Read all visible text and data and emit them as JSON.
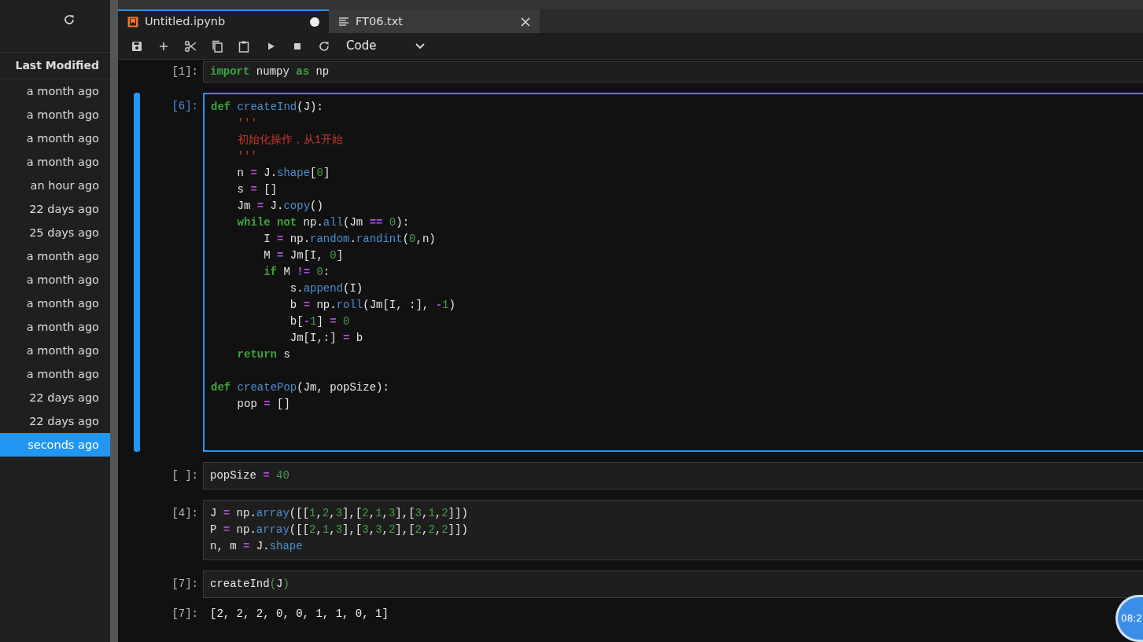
{
  "sidebar": {
    "header": "Last Modified",
    "items": [
      {
        "label": "a month ago",
        "selected": false
      },
      {
        "label": "a month ago",
        "selected": false
      },
      {
        "label": "a month ago",
        "selected": false
      },
      {
        "label": "a month ago",
        "selected": false
      },
      {
        "label": "an hour ago",
        "selected": false
      },
      {
        "label": "22 days ago",
        "selected": false
      },
      {
        "label": "25 days ago",
        "selected": false
      },
      {
        "label": "a month ago",
        "selected": false
      },
      {
        "label": "a month ago",
        "selected": false
      },
      {
        "label": "a month ago",
        "selected": false
      },
      {
        "label": "a month ago",
        "selected": false
      },
      {
        "label": "a month ago",
        "selected": false
      },
      {
        "label": "a month ago",
        "selected": false
      },
      {
        "label": "22 days ago",
        "selected": false
      },
      {
        "label": "22 days ago",
        "selected": false
      },
      {
        "label": "seconds ago",
        "selected": true
      }
    ]
  },
  "tabs": [
    {
      "label": "Untitled.ipynb",
      "kind": "notebook",
      "selected": true,
      "modified": true
    },
    {
      "label": "FT06.txt",
      "kind": "text",
      "selected": false,
      "modified": false
    }
  ],
  "toolbar": {
    "cell_type": "Code"
  },
  "cells": [
    {
      "prompt": "[1]:",
      "active": false,
      "lines": [
        {
          "segments": [
            {
              "text": "import",
              "kind": "keyword"
            },
            {
              "text": " numpy ",
              "kind": "plain"
            },
            {
              "text": "as",
              "kind": "keyword"
            },
            {
              "text": " np",
              "kind": "plain"
            }
          ]
        }
      ]
    },
    {
      "prompt": "[6]:",
      "active": true,
      "extra_space": true,
      "lines": [
        {
          "segments": [
            {
              "text": "def",
              "kind": "keyword"
            },
            {
              "text": " createInd",
              "kind": "function"
            },
            {
              "text": "(J):",
              "kind": "plain"
            }
          ]
        },
        {
          "segments": [
            {
              "text": "    '''",
              "kind": "string"
            }
          ]
        },
        {
          "segments": [
            {
              "text": "    初始化操作，从1开始",
              "kind": "string"
            }
          ]
        },
        {
          "segments": [
            {
              "text": "    '''",
              "kind": "string"
            }
          ]
        },
        {
          "segments": [
            {
              "text": "    n ",
              "kind": "plain"
            },
            {
              "text": "=",
              "kind": "operator"
            },
            {
              "text": " J.",
              "kind": "plain"
            },
            {
              "text": "shape",
              "kind": "function"
            },
            {
              "text": "[",
              "kind": "plain"
            },
            {
              "text": "0",
              "kind": "number"
            },
            {
              "text": "]",
              "kind": "plain"
            }
          ]
        },
        {
          "segments": [
            {
              "text": "    s ",
              "kind": "plain"
            },
            {
              "text": "=",
              "kind": "operator"
            },
            {
              "text": " []",
              "kind": "plain"
            }
          ]
        },
        {
          "segments": [
            {
              "text": "    Jm ",
              "kind": "plain"
            },
            {
              "text": "=",
              "kind": "operator"
            },
            {
              "text": " J.",
              "kind": "plain"
            },
            {
              "text": "copy",
              "kind": "function"
            },
            {
              "text": "()",
              "kind": "plain"
            }
          ]
        },
        {
          "segments": [
            {
              "text": "    while not",
              "kind": "keyword"
            },
            {
              "text": " np.",
              "kind": "plain"
            },
            {
              "text": "all",
              "kind": "function"
            },
            {
              "text": "(Jm ",
              "kind": "plain"
            },
            {
              "text": "==",
              "kind": "operator"
            },
            {
              "text": " 0",
              "kind": "number"
            },
            {
              "text": "):",
              "kind": "plain"
            }
          ]
        },
        {
          "segments": [
            {
              "text": "        I ",
              "kind": "plain"
            },
            {
              "text": "=",
              "kind": "operator"
            },
            {
              "text": " np.",
              "kind": "plain"
            },
            {
              "text": "random",
              "kind": "function"
            },
            {
              "text": ".",
              "kind": "plain"
            },
            {
              "text": "randint",
              "kind": "function"
            },
            {
              "text": "(",
              "kind": "plain"
            },
            {
              "text": "0",
              "kind": "number"
            },
            {
              "text": ",n)",
              "kind": "plain"
            }
          ]
        },
        {
          "segments": [
            {
              "text": "        M ",
              "kind": "plain"
            },
            {
              "text": "=",
              "kind": "operator"
            },
            {
              "text": " Jm[I, ",
              "kind": "plain"
            },
            {
              "text": "0",
              "kind": "number"
            },
            {
              "text": "]",
              "kind": "plain"
            }
          ]
        },
        {
          "segments": [
            {
              "text": "        if",
              "kind": "keyword"
            },
            {
              "text": " M ",
              "kind": "plain"
            },
            {
              "text": "!=",
              "kind": "operator"
            },
            {
              "text": " 0",
              "kind": "number"
            },
            {
              "text": ":",
              "kind": "plain"
            }
          ]
        },
        {
          "segments": [
            {
              "text": "            s.",
              "kind": "plain"
            },
            {
              "text": "append",
              "kind": "function"
            },
            {
              "text": "(I)",
              "kind": "plain"
            }
          ]
        },
        {
          "segments": [
            {
              "text": "            b ",
              "kind": "plain"
            },
            {
              "text": "=",
              "kind": "operator"
            },
            {
              "text": " np.",
              "kind": "plain"
            },
            {
              "text": "roll",
              "kind": "function"
            },
            {
              "text": "(Jm[I, :], ",
              "kind": "plain"
            },
            {
              "text": "-",
              "kind": "operator"
            },
            {
              "text": "1",
              "kind": "number"
            },
            {
              "text": ")",
              "kind": "plain"
            }
          ]
        },
        {
          "segments": [
            {
              "text": "            b[",
              "kind": "plain"
            },
            {
              "text": "-",
              "kind": "operator"
            },
            {
              "text": "1",
              "kind": "number"
            },
            {
              "text": "] ",
              "kind": "plain"
            },
            {
              "text": "=",
              "kind": "operator"
            },
            {
              "text": " 0",
              "kind": "number"
            }
          ]
        },
        {
          "segments": [
            {
              "text": "            Jm[I,:] ",
              "kind": "plain"
            },
            {
              "text": "=",
              "kind": "operator"
            },
            {
              "text": " b",
              "kind": "plain"
            }
          ]
        },
        {
          "segments": [
            {
              "text": "    return",
              "kind": "keyword"
            },
            {
              "text": " s",
              "kind": "plain"
            }
          ]
        },
        {
          "gap_before": true,
          "segments": [
            {
              "text": "def",
              "kind": "keyword"
            },
            {
              "text": " createPop",
              "kind": "function"
            },
            {
              "text": "(Jm, popSize):",
              "kind": "plain"
            }
          ]
        },
        {
          "segments": [
            {
              "text": "    pop ",
              "kind": "plain"
            },
            {
              "text": "=",
              "kind": "operator"
            },
            {
              "text": " []",
              "kind": "plain"
            }
          ]
        }
      ]
    },
    {
      "prompt": "[ ]:",
      "active": false,
      "lines": [
        {
          "segments": [
            {
              "text": "popSize ",
              "kind": "plain"
            },
            {
              "text": "=",
              "kind": "operator"
            },
            {
              "text": " 40",
              "kind": "number"
            }
          ]
        }
      ]
    },
    {
      "prompt": "[4]:",
      "active": false,
      "lines": [
        {
          "segments": [
            {
              "text": "J ",
              "kind": "plain"
            },
            {
              "text": "=",
              "kind": "operator"
            },
            {
              "text": " np.",
              "kind": "plain"
            },
            {
              "text": "array",
              "kind": "function"
            },
            {
              "text": "([[",
              "kind": "plain"
            },
            {
              "text": "1",
              "kind": "number"
            },
            {
              "text": ",",
              "kind": "plain"
            },
            {
              "text": "2",
              "kind": "number"
            },
            {
              "text": ",",
              "kind": "plain"
            },
            {
              "text": "3",
              "kind": "number"
            },
            {
              "text": "],[",
              "kind": "plain"
            },
            {
              "text": "2",
              "kind": "number"
            },
            {
              "text": ",",
              "kind": "plain"
            },
            {
              "text": "1",
              "kind": "number"
            },
            {
              "text": ",",
              "kind": "plain"
            },
            {
              "text": "3",
              "kind": "number"
            },
            {
              "text": "],[",
              "kind": "plain"
            },
            {
              "text": "3",
              "kind": "number"
            },
            {
              "text": ",",
              "kind": "plain"
            },
            {
              "text": "1",
              "kind": "number"
            },
            {
              "text": ",",
              "kind": "plain"
            },
            {
              "text": "2",
              "kind": "number"
            },
            {
              "text": "]])",
              "kind": "plain"
            }
          ]
        },
        {
          "segments": [
            {
              "text": "P ",
              "kind": "plain"
            },
            {
              "text": "=",
              "kind": "operator"
            },
            {
              "text": " np.",
              "kind": "plain"
            },
            {
              "text": "array",
              "kind": "function"
            },
            {
              "text": "([[",
              "kind": "plain"
            },
            {
              "text": "2",
              "kind": "number"
            },
            {
              "text": ",",
              "kind": "plain"
            },
            {
              "text": "1",
              "kind": "number"
            },
            {
              "text": ",",
              "kind": "plain"
            },
            {
              "text": "3",
              "kind": "number"
            },
            {
              "text": "],[",
              "kind": "plain"
            },
            {
              "text": "3",
              "kind": "number"
            },
            {
              "text": ",",
              "kind": "plain"
            },
            {
              "text": "3",
              "kind": "number"
            },
            {
              "text": ",",
              "kind": "plain"
            },
            {
              "text": "2",
              "kind": "number"
            },
            {
              "text": "],[",
              "kind": "plain"
            },
            {
              "text": "2",
              "kind": "number"
            },
            {
              "text": ",",
              "kind": "plain"
            },
            {
              "text": "2",
              "kind": "number"
            },
            {
              "text": ",",
              "kind": "plain"
            },
            {
              "text": "2",
              "kind": "number"
            },
            {
              "text": "]])",
              "kind": "plain"
            }
          ]
        },
        {
          "segments": [
            {
              "text": "n, m ",
              "kind": "plain"
            },
            {
              "text": "=",
              "kind": "operator"
            },
            {
              "text": " J.",
              "kind": "plain"
            },
            {
              "text": "shape",
              "kind": "function"
            }
          ]
        }
      ]
    },
    {
      "prompt": "[7]:",
      "active": false,
      "lines": [
        {
          "segments": [
            {
              "text": "createInd",
              "kind": "plain"
            },
            {
              "text": "(",
              "kind": "number"
            },
            {
              "text": "J",
              "kind": "plain"
            },
            {
              "text": ")",
              "kind": "number"
            }
          ]
        }
      ],
      "output": {
        "prompt": "[7]:",
        "text": "[2, 2, 2, 0, 0, 1, 1, 0, 1]"
      }
    }
  ],
  "clock": "08:2"
}
